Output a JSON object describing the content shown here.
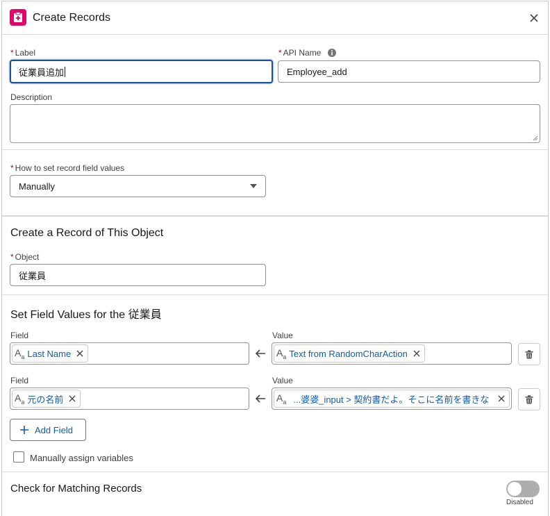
{
  "header": {
    "title": "Create Records",
    "app_icon": "clipboard-icon",
    "accent": "#e3066a"
  },
  "form": {
    "label_field": {
      "required": "*",
      "label": "Label",
      "value": "従業員追加"
    },
    "api_field": {
      "required": "*",
      "label": "API Name",
      "value": "Employee_add"
    },
    "description_field": {
      "label": "Description",
      "value": ""
    },
    "how_to_set": {
      "required": "*",
      "label": "How to set record field values",
      "value": "Manually"
    }
  },
  "create_section": {
    "title": "Create a Record of This Object",
    "object_field": {
      "required": "*",
      "label": "Object",
      "value": "従業員"
    }
  },
  "field_values": {
    "title": "Set Field Values for the 従業員",
    "rows": [
      {
        "field_label": "Field",
        "field_value": "Last Name",
        "value_label": "Value",
        "value_value": "Text from RandomCharAction"
      },
      {
        "field_label": "Field",
        "field_value": "元の名前",
        "value_label": "Value",
        "value_value": "...婆婆_input > 契約書だよ。そこに名前を書きな"
      }
    ],
    "add_field_label": "Add Field",
    "manual_assign_label": "Manually assign variables"
  },
  "matching": {
    "title": "Check for Matching Records",
    "toggle_status": "Disabled"
  },
  "colors": {
    "link": "#0b5cab",
    "focus": "#1b5297",
    "required": "#ba0517"
  }
}
